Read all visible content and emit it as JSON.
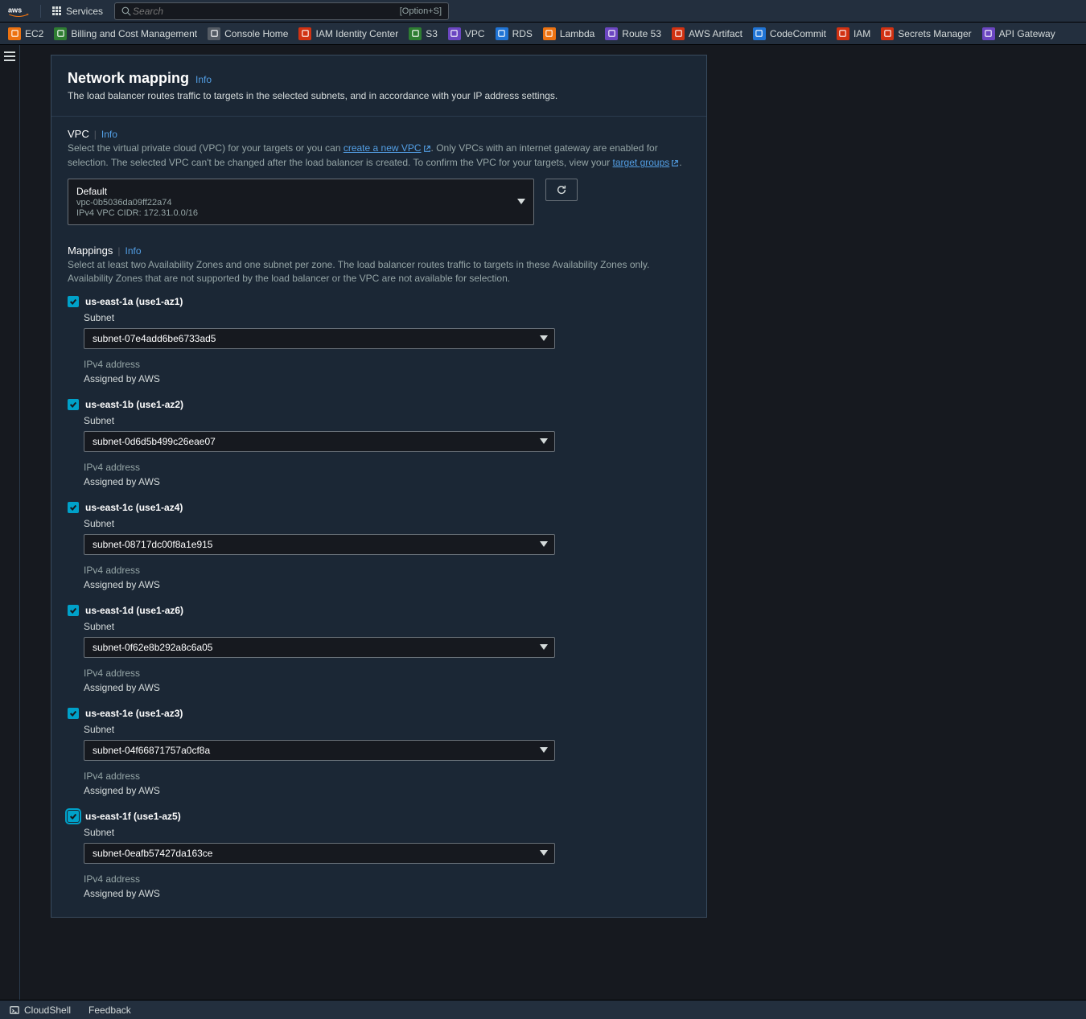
{
  "topbar": {
    "services_label": "Services",
    "search_placeholder": "Search",
    "search_hint": "[Option+S]"
  },
  "svcbar": {
    "items": [
      {
        "label": "EC2",
        "color": "#ec7211"
      },
      {
        "label": "Billing and Cost Management",
        "color": "#2e7d32"
      },
      {
        "label": "Console Home",
        "color": "#545b64"
      },
      {
        "label": "IAM Identity Center",
        "color": "#d13212"
      },
      {
        "label": "S3",
        "color": "#2e7d32"
      },
      {
        "label": "VPC",
        "color": "#6b46c1"
      },
      {
        "label": "RDS",
        "color": "#2074d5"
      },
      {
        "label": "Lambda",
        "color": "#ec7211"
      },
      {
        "label": "Route 53",
        "color": "#6b46c1"
      },
      {
        "label": "AWS Artifact",
        "color": "#d13212"
      },
      {
        "label": "CodeCommit",
        "color": "#2074d5"
      },
      {
        "label": "IAM",
        "color": "#d13212"
      },
      {
        "label": "Secrets Manager",
        "color": "#d13212"
      },
      {
        "label": "API Gateway",
        "color": "#6b46c1"
      }
    ]
  },
  "panel": {
    "title": "Network mapping",
    "info": "Info",
    "desc": "The load balancer routes traffic to targets in the selected subnets, and in accordance with your IP address settings.",
    "vpc": {
      "label": "VPC",
      "info": "Info",
      "help_pre": "Select the virtual private cloud (VPC) for your targets or you can ",
      "create_link": "create a new VPC",
      "help_mid": ". Only VPCs with an internet gateway are enabled for selection. The selected VPC can't be changed after the load balancer is created. To confirm the VPC for your targets, view your ",
      "targets_link": "target groups",
      "help_end": ".",
      "selected_name": "Default",
      "selected_id": "vpc-0b5036da09ff22a74",
      "selected_cidr": "IPv4 VPC CIDR: 172.31.0.0/16"
    },
    "mappings": {
      "label": "Mappings",
      "info": "Info",
      "help": "Select at least two Availability Zones and one subnet per zone. The load balancer routes traffic to targets in these Availability Zones only. Availability Zones that are not supported by the load balancer or the VPC are not available for selection.",
      "subnet_label": "Subnet",
      "ipv4_label": "IPv4 address",
      "ipv4_value": "Assigned by AWS",
      "zones": [
        {
          "az": "us-east-1a (use1-az1)",
          "subnet": "subnet-07e4add6be6733ad5",
          "checked": true,
          "focused": false
        },
        {
          "az": "us-east-1b (use1-az2)",
          "subnet": "subnet-0d6d5b499c26eae07",
          "checked": true,
          "focused": false
        },
        {
          "az": "us-east-1c (use1-az4)",
          "subnet": "subnet-08717dc00f8a1e915",
          "checked": true,
          "focused": false
        },
        {
          "az": "us-east-1d (use1-az6)",
          "subnet": "subnet-0f62e8b292a8c6a05",
          "checked": true,
          "focused": false
        },
        {
          "az": "us-east-1e (use1-az3)",
          "subnet": "subnet-04f66871757a0cf8a",
          "checked": true,
          "focused": false
        },
        {
          "az": "us-east-1f (use1-az5)",
          "subnet": "subnet-0eafb57427da163ce",
          "checked": true,
          "focused": true
        }
      ]
    }
  },
  "statusbar": {
    "cloudshell": "CloudShell",
    "feedback": "Feedback"
  }
}
